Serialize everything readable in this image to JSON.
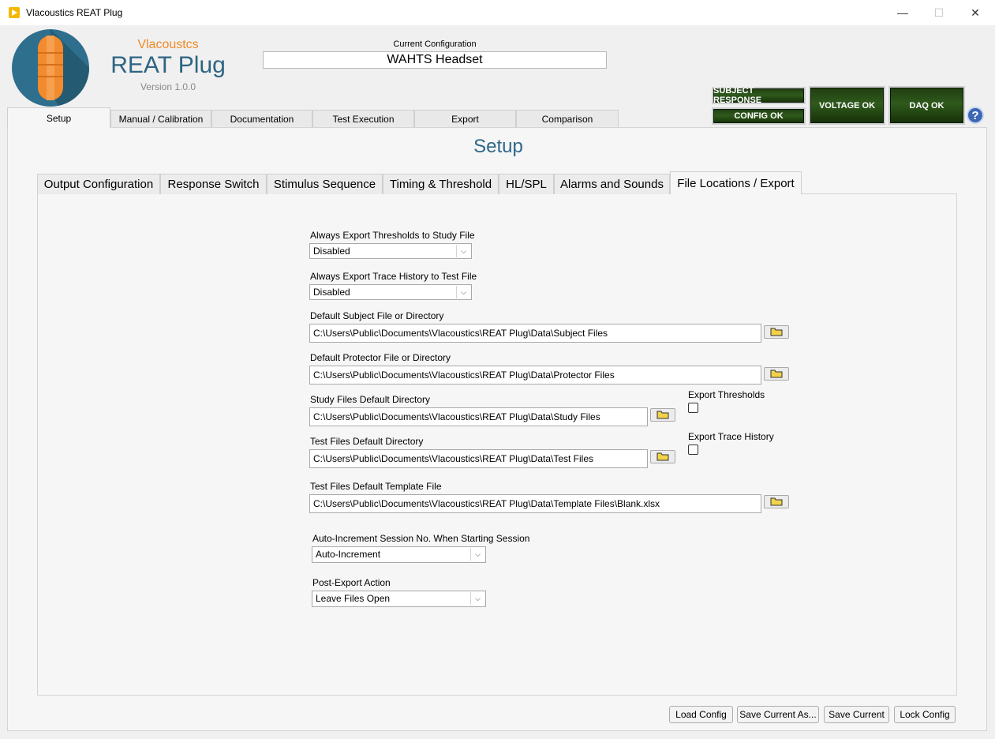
{
  "window": {
    "title": "Vlacoustics REAT Plug",
    "minimize": "—",
    "maximize": "☐",
    "close": "✕"
  },
  "brand": {
    "company": "Vlacoustcs",
    "product": "REAT Plug",
    "version": "Version 1.0.0"
  },
  "config": {
    "label": "Current Configuration",
    "value": "WAHTS Headset"
  },
  "status": {
    "subject": "SUBJECT RESPONSE",
    "config": "CONFIG OK",
    "voltage": "VOLTAGE OK",
    "daq": "DAQ OK",
    "help": "?"
  },
  "main_tabs": [
    "Setup",
    "Manual / Calibration",
    "Documentation",
    "Test Execution",
    "Export",
    "Comparison"
  ],
  "page_title": "Setup",
  "inner_tabs": [
    "Output Configuration",
    "Response Switch",
    "Stimulus Sequence",
    "Timing & Threshold",
    "HL/SPL",
    "Alarms and Sounds",
    "File Locations / Export"
  ],
  "form": {
    "export_thresholds_study": {
      "label": "Always Export Thresholds to Study File",
      "value": "Disabled"
    },
    "export_trace_test": {
      "label": "Always Export Trace History to Test File",
      "value": "Disabled"
    },
    "subject_dir": {
      "label": "Default Subject File or Directory",
      "value": "C:\\Users\\Public\\Documents\\Vlacoustics\\REAT Plug\\Data\\Subject Files"
    },
    "protector_dir": {
      "label": "Default Protector File or Directory",
      "value": "C:\\Users\\Public\\Documents\\Vlacoustics\\REAT Plug\\Data\\Protector Files"
    },
    "study_dir": {
      "label": "Study Files Default Directory",
      "value": "C:\\Users\\Public\\Documents\\Vlacoustics\\REAT Plug\\Data\\Study Files"
    },
    "test_dir": {
      "label": "Test Files Default Directory",
      "value": "C:\\Users\\Public\\Documents\\Vlacoustics\\REAT Plug\\Data\\Test Files"
    },
    "template_file": {
      "label": "Test Files Default Template File",
      "value": "C:\\Users\\Public\\Documents\\Vlacoustics\\REAT Plug\\Data\\Template Files\\Blank.xlsx"
    },
    "export_thresholds_chk": {
      "label": "Export Thresholds"
    },
    "export_trace_chk": {
      "label": "Export Trace History"
    },
    "auto_increment": {
      "label": "Auto-Increment Session No. When Starting Session",
      "value": "Auto-Increment"
    },
    "post_export": {
      "label": "Post-Export Action",
      "value": "Leave Files Open"
    }
  },
  "buttons": {
    "load": "Load Config",
    "save_as": "Save Current As...",
    "save": "Save Current",
    "lock": "Lock Config"
  }
}
